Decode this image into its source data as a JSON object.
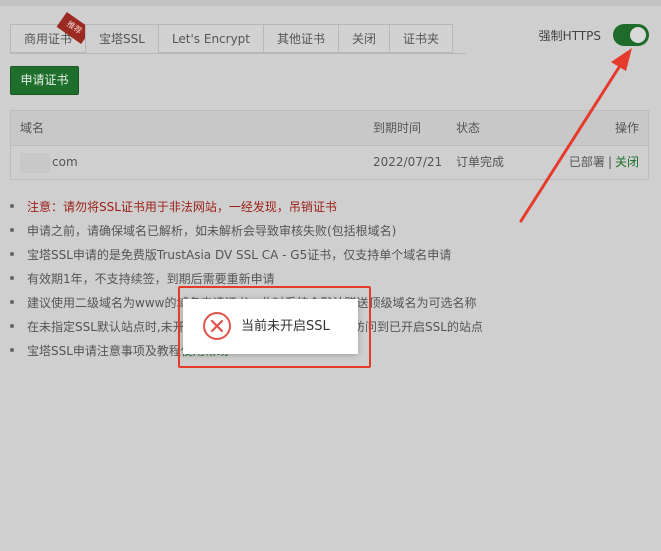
{
  "tabs": [
    {
      "label": "商用证书",
      "badge": "推荐"
    },
    {
      "label": "宝塔SSL",
      "active": true
    },
    {
      "label": "Let's Encrypt"
    },
    {
      "label": "其他证书"
    },
    {
      "label": "关闭"
    },
    {
      "label": "证书夹"
    }
  ],
  "https": {
    "label": "强制HTTPS",
    "enabled": true
  },
  "apply_button": "申请证书",
  "table": {
    "headers": {
      "domain": "域名",
      "expire": "到期时间",
      "status": "状态",
      "action": "操作"
    },
    "rows": [
      {
        "domain": "com",
        "expire": "2022/07/21",
        "status": "订单完成",
        "deployed": "已部署",
        "separator": "|",
        "close": "关闭"
      }
    ]
  },
  "notes": [
    "注意：请勿将SSL证书用于非法网站，一经发现，吊销证书",
    "申请之前，请确保域名已解析，如未解析会导致审核失败(包括根域名)",
    "宝塔SSL申请的是免费版TrustAsia DV SSL CA - G5证书，仅支持单个域名申请",
    "有效期1年，不支持续签，到期后需要重新申请",
    "建议使用二级域名为www的域名申请证书，此时系统会默认赠送顶级域名为可选名称",
    "在未指定SSL默认站点时,未开启SSL的站点使用HTTPS会直接访问到已开启SSL的站点",
    "宝塔SSL申请注意事项及教程"
  ],
  "notes_link": "使用帮助",
  "toast": {
    "text": "当前未开启SSL",
    "icon": "error-circle-icon"
  },
  "colors": {
    "accent_green": "#1f6f2c",
    "warning_red": "#9b1e17",
    "annotation_red": "#e53b2c"
  }
}
